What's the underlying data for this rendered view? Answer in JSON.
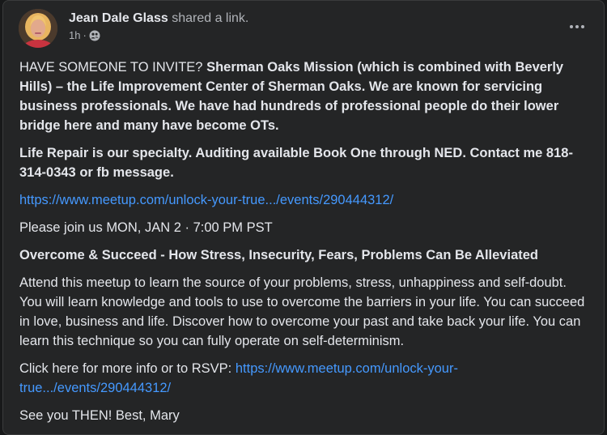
{
  "post": {
    "author": "Jean Dale Glass",
    "action": "shared a link.",
    "time": "1h",
    "separator": "·",
    "privacy_icon": "friends-icon",
    "more_icon": "more-horizontal-icon"
  },
  "content": {
    "p1_lead": "HAVE SOMEONE TO INVITE? ",
    "p1_bold": "Sherman Oaks Mission (which is combined with Beverly Hills) – the Life Improvement Center of Sherman Oaks. We are known for servicing business professionals. We have had hundreds of professional people do their lower bridge here and many have become OTs.",
    "p2_bold": "Life Repair is our specialty. Auditing available Book One through NED. Contact me 818-314-0343 or fb message.",
    "link1": "https://www.meetup.com/unlock-your-true.../events/290444312/",
    "p3": "Please join us MON, JAN 2 · 7:00 PM PST",
    "p4_bold": "Overcome & Succeed - How Stress, Insecurity, Fears, Problems Can Be Alleviated",
    "p5": "Attend this meetup to learn the source of your problems, stress, unhappiness and self-doubt. You will learn knowledge and tools to use to overcome the barriers in your life. You can succeed in love, business and life. Discover how to overcome your past and take back your life. You can learn this technique so you can fully operate on self-determinism.",
    "p6_lead": "Click here for more info or to RSVP: ",
    "link2": "https://www.meetup.com/unlock-your-true.../events/290444312/",
    "p7": "See you THEN! Best, Mary"
  },
  "colors": {
    "background": "#242526",
    "text": "#e4e6eb",
    "secondary_text": "#b0b3b8",
    "link": "#4599ff"
  }
}
